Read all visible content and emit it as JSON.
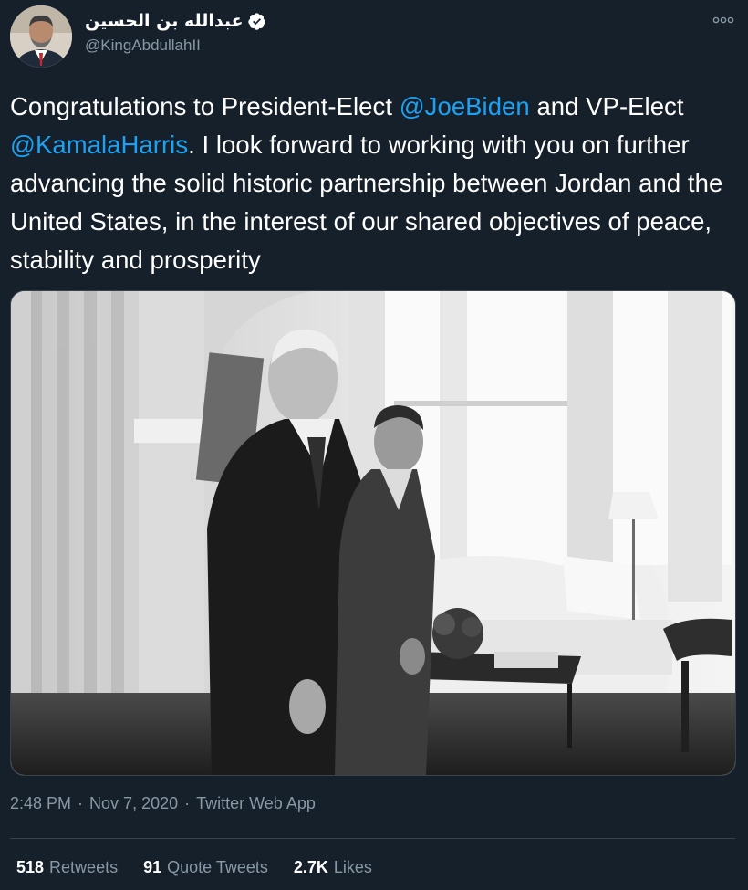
{
  "tweet": {
    "author": {
      "display_name": "عبدالله بن الحسين",
      "handle": "@KingAbdullahII",
      "verified": true
    },
    "text": {
      "t1": "Congratulations to President-Elect ",
      "m1": "@JoeBiden",
      "t2": " and VP-Elect ",
      "m2": "@KamalaHarris",
      "t3": ". I look forward to working with you on further advancing the solid historic partnership between Jordan and the United States, in the interest of our shared objectives of peace, stability and prosperity"
    },
    "meta": {
      "time": "2:48 PM",
      "sep1": "·",
      "date": "Nov 7, 2020",
      "sep2": "·",
      "source": "Twitter Web App"
    },
    "stats": {
      "retweets_count": "518",
      "retweets_label": "Retweets",
      "quotes_count": "91",
      "quotes_label": "Quote Tweets",
      "likes_count": "2.7K",
      "likes_label": "Likes"
    }
  },
  "icons": {
    "verified": "verified-badge-icon",
    "more": "more-options-icon"
  },
  "colors": {
    "background": "#15202b",
    "text": "#ffffff",
    "secondary": "#8899a6",
    "link": "#1da1f2",
    "border": "#38444d"
  }
}
